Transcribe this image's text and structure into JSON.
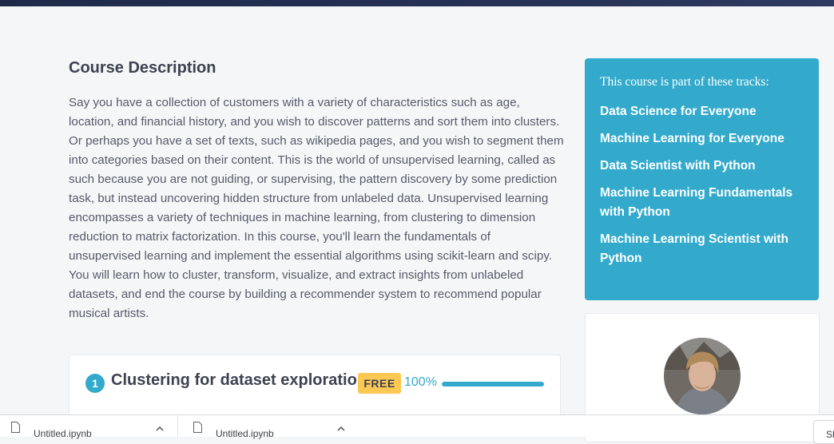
{
  "description": {
    "title": "Course Description",
    "text": "Say you have a collection of customers with a variety of characteristics such as age, location, and financial history, and you wish to discover patterns and sort them into clusters. Or perhaps you have a set of texts, such as wikipedia pages, and you wish to segment them into categories based on their content. This is the world of unsupervised learning, called as such because you are not guiding, or supervising, the pattern discovery by some prediction task, but instead uncovering hidden structure from unlabeled data. Unsupervised learning encompasses a variety of techniques in machine learning, from clustering to dimension reduction to matrix factorization. In this course, you'll learn the fundamentals of unsupervised learning and implement the essential algorithms using scikit-learn and scipy. You will learn how to cluster, transform, visualize, and extract insights from unlabeled datasets, and end the course by building a recommender system to recommend popular musical artists."
  },
  "chapter": {
    "number": "1",
    "title": "Clustering for dataset exploration",
    "badge": "FREE",
    "progress_label": "100%",
    "progress_fraction": 1.0
  },
  "tracks": {
    "heading": "This course is part of these tracks:",
    "items": [
      "Data Science for Everyone",
      "Machine Learning for Everyone",
      "Data Scientist with Python",
      "Machine Learning Fundamentals with Python",
      "Machine Learning Scientist with Python"
    ]
  },
  "downloads": {
    "items": [
      "Untitled.ipynb",
      "Untitled.ipynb"
    ],
    "show_all_label": "Sh"
  },
  "colors": {
    "accent": "#33aacc",
    "badge": "#fbc853",
    "top_bar": "#1f2a49"
  }
}
